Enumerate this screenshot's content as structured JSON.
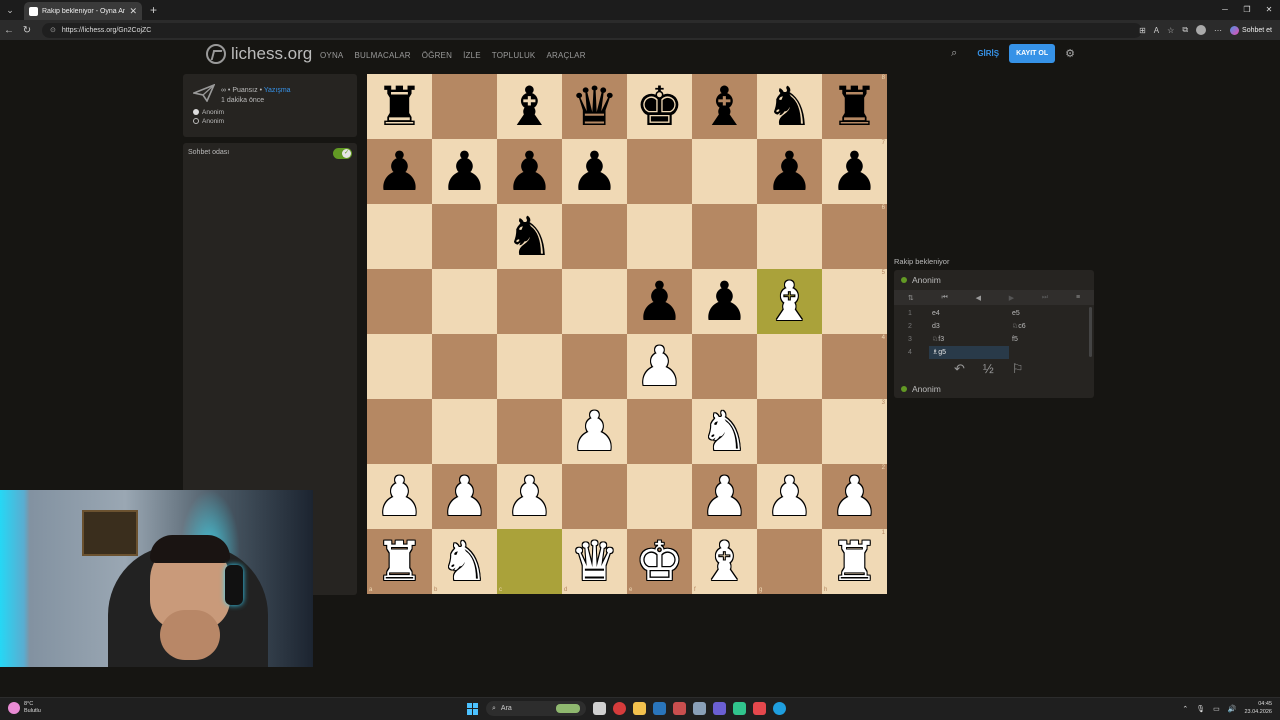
{
  "browser": {
    "tab_title": "Rakip bekleniyor - Oyna Anon. • li",
    "url": "https://lichess.org/Gn2CojZC",
    "profile_button": "Sohbet et"
  },
  "header": {
    "logo_text": "lichess.org",
    "nav": [
      "OYNA",
      "BULMACALAR",
      "ÖĞREN",
      "İZLE",
      "TOPLULUK",
      "ARAÇLAR"
    ],
    "login": "GİRİŞ",
    "signup": "KAYIT OL"
  },
  "game_info": {
    "mode_prefix": "∞ • Puansız • ",
    "mode_link": "Yazışma",
    "time_ago": "1 dakika önce",
    "white_player": "Anonim",
    "black_player": "Anonim"
  },
  "chat": {
    "label": "Sohbet odası",
    "enabled": true
  },
  "board": {
    "ranks": [
      "8",
      "7",
      "6",
      "5",
      "4",
      "3",
      "2",
      "1"
    ],
    "files": [
      "a",
      "b",
      "c",
      "d",
      "e",
      "f",
      "g",
      "h"
    ],
    "rows": [
      [
        "bR",
        "",
        "bB",
        "bQ",
        "bK",
        "bB",
        "bN",
        "bR"
      ],
      [
        "bP",
        "bP",
        "bP",
        "bP",
        "",
        "",
        "bP",
        "bP"
      ],
      [
        "",
        "",
        "bN",
        "",
        "",
        "",
        "",
        ""
      ],
      [
        "",
        "",
        "",
        "",
        "bP",
        "bP",
        "wB",
        ""
      ],
      [
        "",
        "",
        "",
        "",
        "wP",
        "",
        "",
        ""
      ],
      [
        "",
        "",
        "",
        "wP",
        "",
        "wN",
        "",
        ""
      ],
      [
        "wP",
        "wP",
        "wP",
        "",
        "",
        "wP",
        "wP",
        "wP"
      ],
      [
        "wR",
        "wN",
        "",
        "wQ",
        "wK",
        "wB",
        "",
        "wR"
      ]
    ],
    "highlight": [
      "c1",
      "g5"
    ]
  },
  "side": {
    "status": "Rakip bekleniyor",
    "top_player": "Anonim",
    "bottom_player": "Anonim",
    "moves": [
      {
        "n": "1",
        "w": "e4",
        "b": "e5"
      },
      {
        "n": "2",
        "w": "d3",
        "b": "♘c6"
      },
      {
        "n": "3",
        "w": "♘f3",
        "b": "f5"
      },
      {
        "n": "4",
        "w": "♗g5",
        "b": ""
      }
    ],
    "draw_label": "½"
  },
  "taskbar": {
    "temp": "8°C",
    "weather": "Bulutlu",
    "search": "Ara",
    "time": "04:45",
    "date": "23.04.2026"
  }
}
